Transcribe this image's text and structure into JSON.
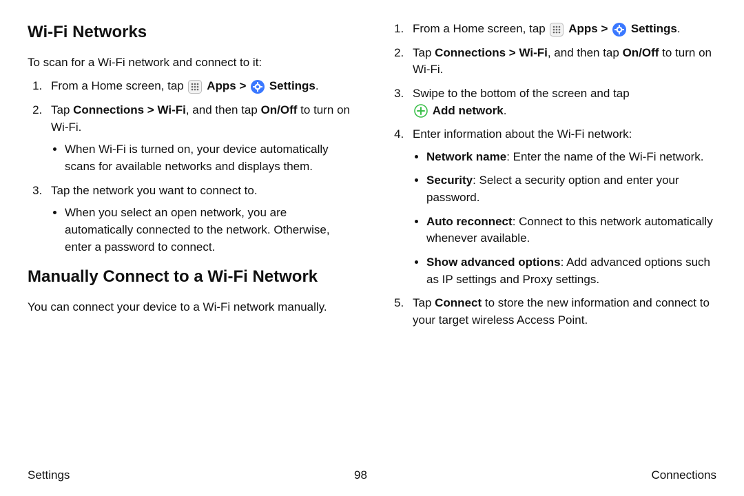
{
  "left": {
    "h1": "Wi-Fi Networks",
    "intro": "To scan for a Wi-Fi network and connect to it:",
    "s1a": "From a Home screen, tap ",
    "apps": "Apps",
    "gt": " > ",
    "settings": "Settings",
    "dot": ".",
    "s2a": "Tap ",
    "s2b": "Connections > Wi-Fi",
    "s2c": ", and then tap ",
    "s2d": "On/Off",
    "s2e": " to turn on Wi-Fi.",
    "s2bul": "When Wi-Fi is turned on, your device automatically scans for available networks and displays them.",
    "s3": "Tap the network you want to connect to.",
    "s3bul": "When you select an open network, you are automatically connected to the network. Otherwise, enter a password to connect.",
    "h2": "Manually Connect to a Wi-Fi Network",
    "intro2": "You can connect your device to a Wi-Fi network manually."
  },
  "right": {
    "s1a": "From a Home screen, tap ",
    "apps": "Apps",
    "gt": " > ",
    "settings": "Settings",
    "dot": ".",
    "s2a": "Tap ",
    "s2b": "Connections > Wi-Fi",
    "s2c": ", and then tap ",
    "s2d": "On/Off",
    "s2e": " to turn on Wi-Fi.",
    "s3": "Swipe to the bottom of the screen and tap ",
    "addnet": "Add network",
    "s4": "Enter information about the Wi-Fi network:",
    "b1a": "Network name",
    "b1b": ": Enter the name of the Wi-Fi network.",
    "b2a": "Security",
    "b2b": ": Select a security option and enter your password.",
    "b3a": "Auto reconnect",
    "b3b": ": Connect to this network automatically whenever available.",
    "b4a": "Show advanced options",
    "b4b": ": Add advanced options such as IP settings and Proxy settings.",
    "s5a": "Tap ",
    "s5b": "Connect",
    "s5c": " to store the new information and connect to your target wireless Access Point."
  },
  "footer": {
    "left": "Settings",
    "center": "98",
    "right": "Connections"
  }
}
